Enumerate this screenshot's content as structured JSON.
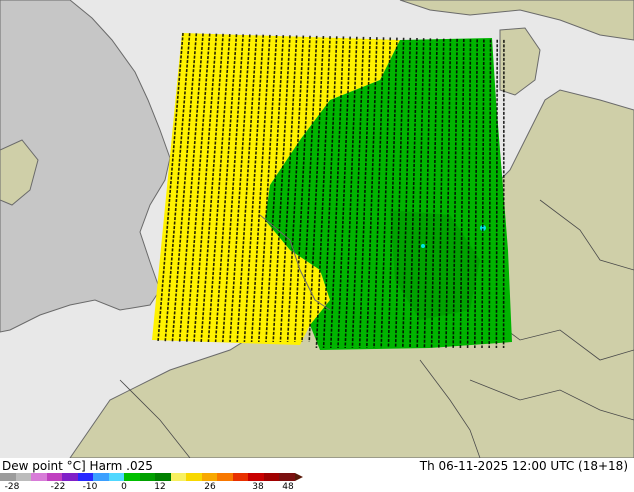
{
  "map": {
    "colors": {
      "sea": "#e8e8e8",
      "land": "#cfcfa8",
      "uk_land": "#c8c8c8",
      "border": "#4a4a4a",
      "coast": "#6a6a6a",
      "yellow_field": "#fff200",
      "green_field": "#00b400",
      "dark_green": "#009000",
      "cyan_spot": "#00e5e5"
    },
    "icons": [
      "contour-labels",
      "field-overlay"
    ]
  },
  "footer": {
    "title_left": "Dew point °C] Harm .025",
    "title_right": "Th 06-11-2025 12:00 UTC (18+18)",
    "colorbar": {
      "colors": [
        "#9c9c9c",
        "#bcbcbc",
        "#d87cd8",
        "#c040c0",
        "#8020c8",
        "#2828ff",
        "#3ca0ff",
        "#50d8ff",
        "#00c000",
        "#00a000",
        "#008000",
        "#f8f060",
        "#f8d800",
        "#f8a800",
        "#f87800",
        "#e83000",
        "#c80000",
        "#a00000",
        "#7a1010"
      ],
      "ticks": [
        "-28",
        "-22",
        "-10",
        "0",
        "12",
        "26",
        "38",
        "48"
      ]
    }
  }
}
